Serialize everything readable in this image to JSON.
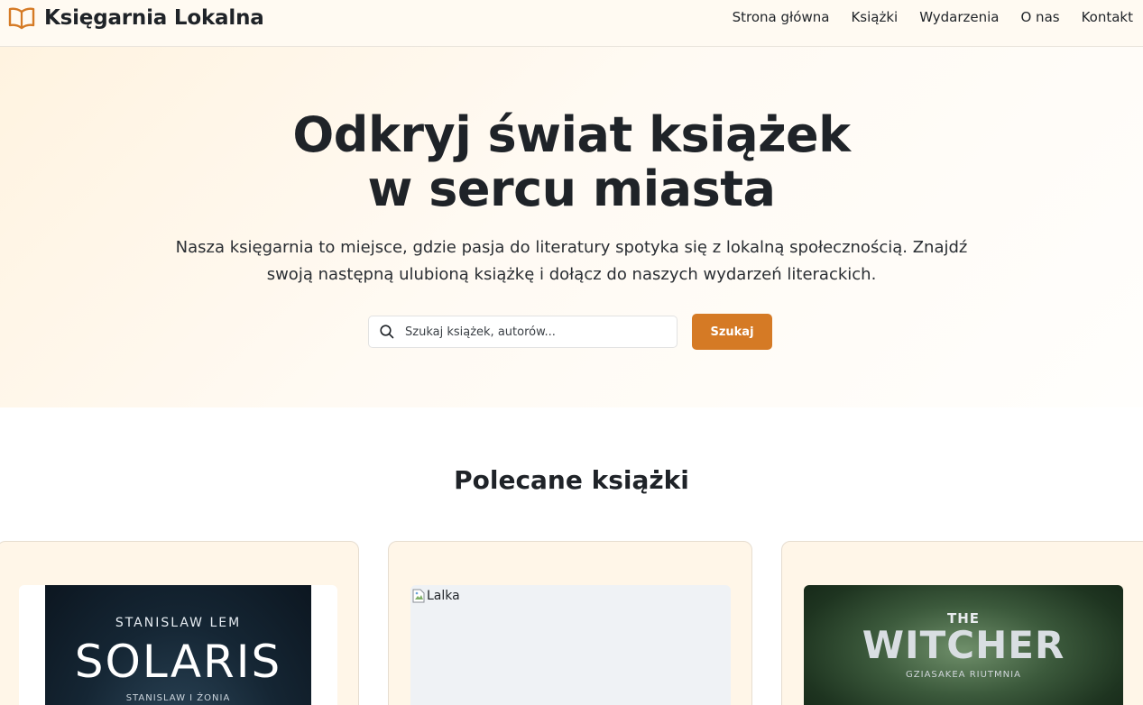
{
  "header": {
    "brand": "Księgarnia Lokalna",
    "nav": [
      "Strona główna",
      "Książki",
      "Wydarzenia",
      "O nas",
      "Kontakt"
    ]
  },
  "hero": {
    "title_line1": "Odkryj świat książek",
    "title_line2": "w sercu miasta",
    "description": "Nasza księgarnia to miejsce, gdzie pasja do literatury spotyka się z lokalną społecznością. Znajdź swoją następną ulubioną książkę i dołącz do naszych wydarzeń literackich.",
    "search_placeholder": "Szukaj książek, autorów...",
    "search_button": "Szukaj"
  },
  "featured": {
    "title": "Polecane książki",
    "books": [
      {
        "cover_author": "STANISLAW LEM",
        "cover_title": "SOLARIS",
        "cover_subtitle": "STANISLAW I ŻONIA"
      },
      {
        "alt": "Lalka"
      },
      {
        "cover_top": "THE",
        "cover_title": "WITCHER",
        "cover_subtitle": "GZIASAKEA RIUTMNIA"
      }
    ]
  },
  "colors": {
    "accent": "#d57a25",
    "header_bg": "#fffaf2",
    "card_bg": "#fff6e8"
  }
}
